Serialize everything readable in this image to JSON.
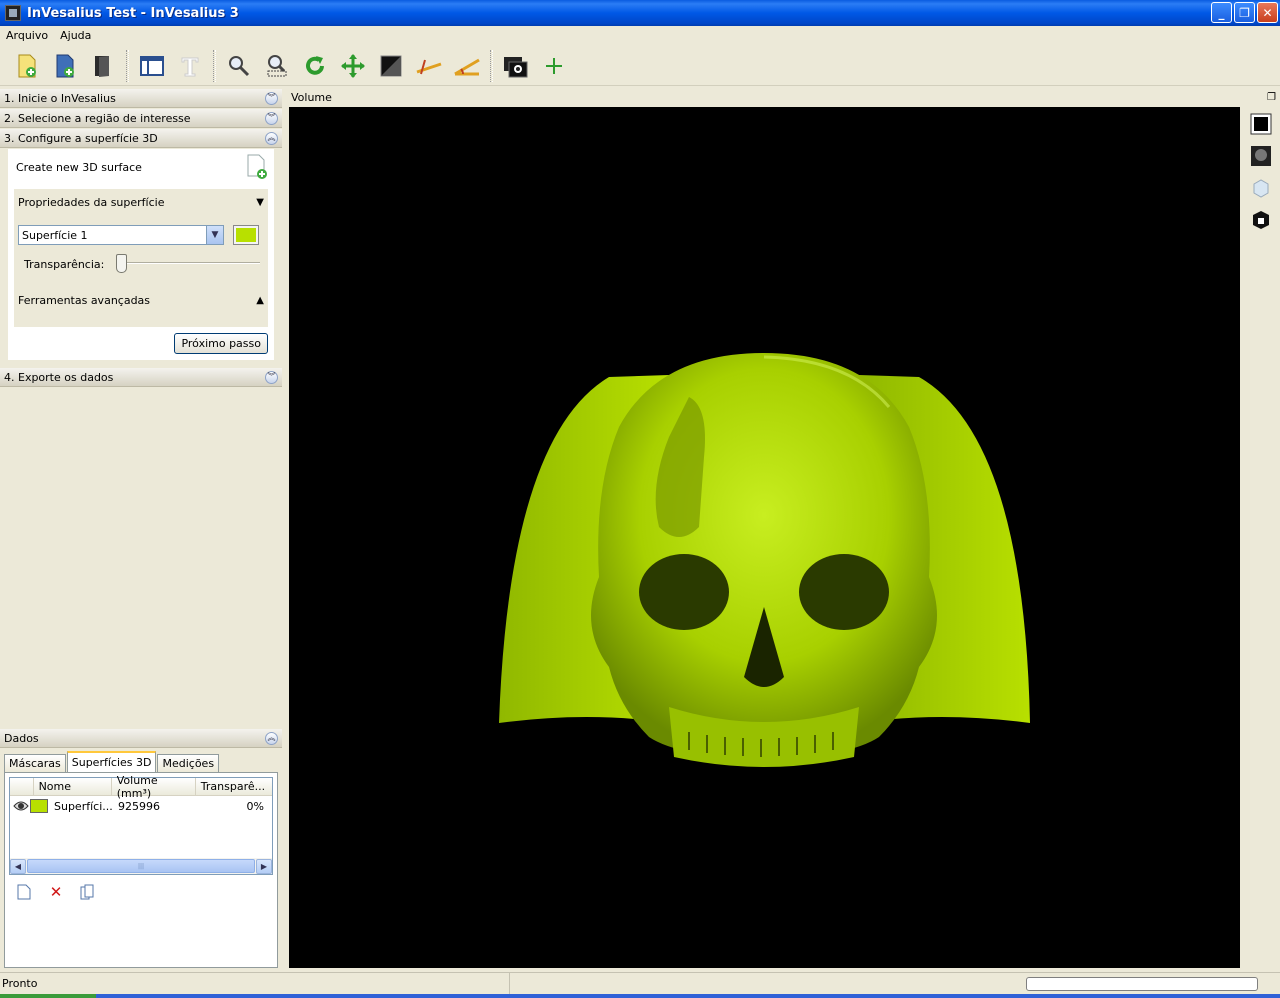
{
  "window": {
    "title": "InVesalius Test - InVesalius 3",
    "minimize_label": "_",
    "maximize_label": "❐",
    "close_label": "✕"
  },
  "menu": {
    "items": [
      "Arquivo",
      "Ajuda"
    ]
  },
  "toolbar": {
    "icons": [
      "import-dicom-icon",
      "open-project-icon",
      "close-project-icon",
      "layout-icon",
      "text-icon",
      "zoom-icon",
      "zoom-select-icon",
      "rotate-icon",
      "pan-icon",
      "contrast-icon",
      "measure-distance-icon",
      "measure-angle-icon",
      "snapshot-icon",
      "add-icon"
    ]
  },
  "left_panel": {
    "steps": [
      {
        "label": "1. Inicie o InVesalius"
      },
      {
        "label": "2. Selecione a região de interesse"
      },
      {
        "label": "3. Configure a superfície 3D"
      },
      {
        "label": "4. Exporte os dados"
      }
    ],
    "step3": {
      "create_label": "Create new 3D surface",
      "properties_label": "Propriedades da superfície",
      "properties_toggle": "▼",
      "surface_select": "Superfície 1",
      "surface_color": "#b8e000",
      "transparency_label": "Transparência:",
      "transparency_value": 0,
      "advanced_label": "Ferramentas avançadas",
      "advanced_toggle": "▲",
      "next_button": "Próximo passo"
    }
  },
  "data_panel": {
    "title": "Dados",
    "tabs": [
      "Máscaras",
      "Superfícies 3D",
      "Medições"
    ],
    "active_tab": 1,
    "columns": [
      "Nome",
      "Volume (mm³)",
      "Transparê..."
    ],
    "rows": [
      {
        "name": "Superfíci...",
        "volume": "925996",
        "transparency": "0%",
        "color": "#b8e000"
      }
    ]
  },
  "viewer": {
    "title": "Volume",
    "background": "#000000",
    "surface_color": "#b8e000"
  },
  "status": {
    "text": "Pronto"
  }
}
